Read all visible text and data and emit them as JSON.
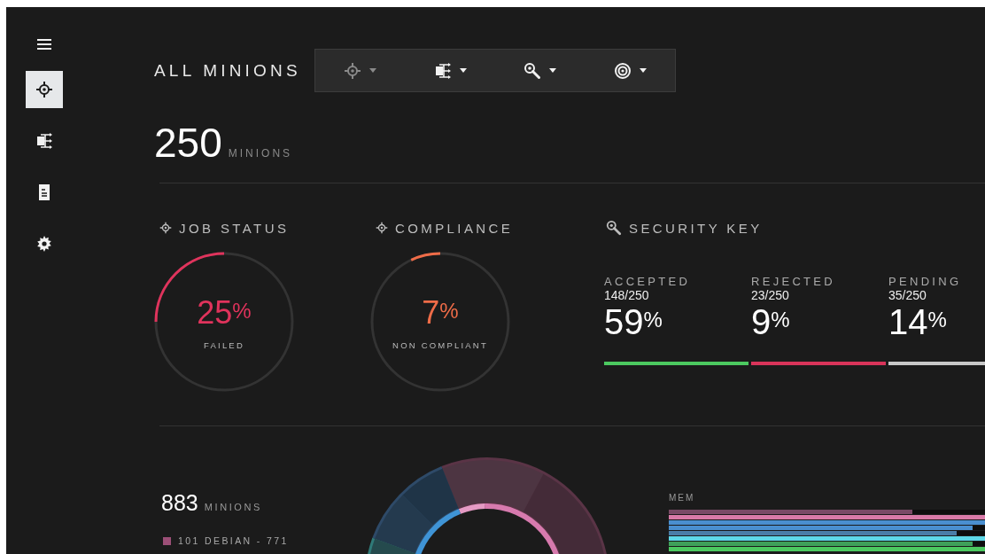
{
  "sidebar": {
    "items": [
      {
        "kind": "menu",
        "selected": false
      },
      {
        "kind": "crosshair",
        "selected": true
      },
      {
        "kind": "branch",
        "selected": false
      },
      {
        "kind": "document",
        "selected": false
      },
      {
        "kind": "gear",
        "selected": false
      }
    ]
  },
  "header": {
    "title": "ALL MINIONS",
    "filters": [
      {
        "kind": "crosshair",
        "disabled": true
      },
      {
        "kind": "branch",
        "disabled": false
      },
      {
        "kind": "key",
        "disabled": false
      },
      {
        "kind": "target",
        "disabled": false
      }
    ]
  },
  "summary": {
    "count": "250",
    "unit": "MINIONS"
  },
  "gauges": [
    {
      "title": "JOB STATUS",
      "value": "25",
      "unit": "%",
      "caption": "FAILED",
      "color": "#e0335c"
    },
    {
      "title": "COMPLIANCE",
      "value": "7",
      "unit": "%",
      "caption": "NON COMPLIANT",
      "color": "#ef6c48"
    }
  ],
  "security_key": {
    "title": "SECURITY KEY",
    "stats": [
      {
        "label": "ACCEPTED",
        "fraction": "148/250",
        "value": "59",
        "unit": "%",
        "color": "#4cc960"
      },
      {
        "label": "REJECTED",
        "fraction": "23/250",
        "value": "9",
        "unit": "%",
        "color": "#d9345a"
      },
      {
        "label": "PENDING",
        "fraction": "35/250",
        "value": "14",
        "unit": "%",
        "color": "#c8c8c8"
      }
    ]
  },
  "distribution": {
    "count": "883",
    "unit": "MINIONS",
    "legend": [
      {
        "label": "101 DEBIAN - 771",
        "color": "#9c4f77"
      }
    ]
  },
  "mem": {
    "title": "MEM",
    "bars": [
      {
        "level": 0.77,
        "color": "#7a4a66"
      },
      {
        "level": 1,
        "color": "#d97aa8"
      },
      {
        "level": 1,
        "color": "#4a8fd0"
      },
      {
        "level": 0.96,
        "color": "#4a8fd0"
      },
      {
        "level": 0.91,
        "color": "#4a7ea8"
      },
      {
        "level": 1,
        "color": "#5ed8e8"
      },
      {
        "level": 0.96,
        "color": "#3fa05a"
      },
      {
        "level": 1,
        "color": "#4cc960"
      }
    ]
  }
}
